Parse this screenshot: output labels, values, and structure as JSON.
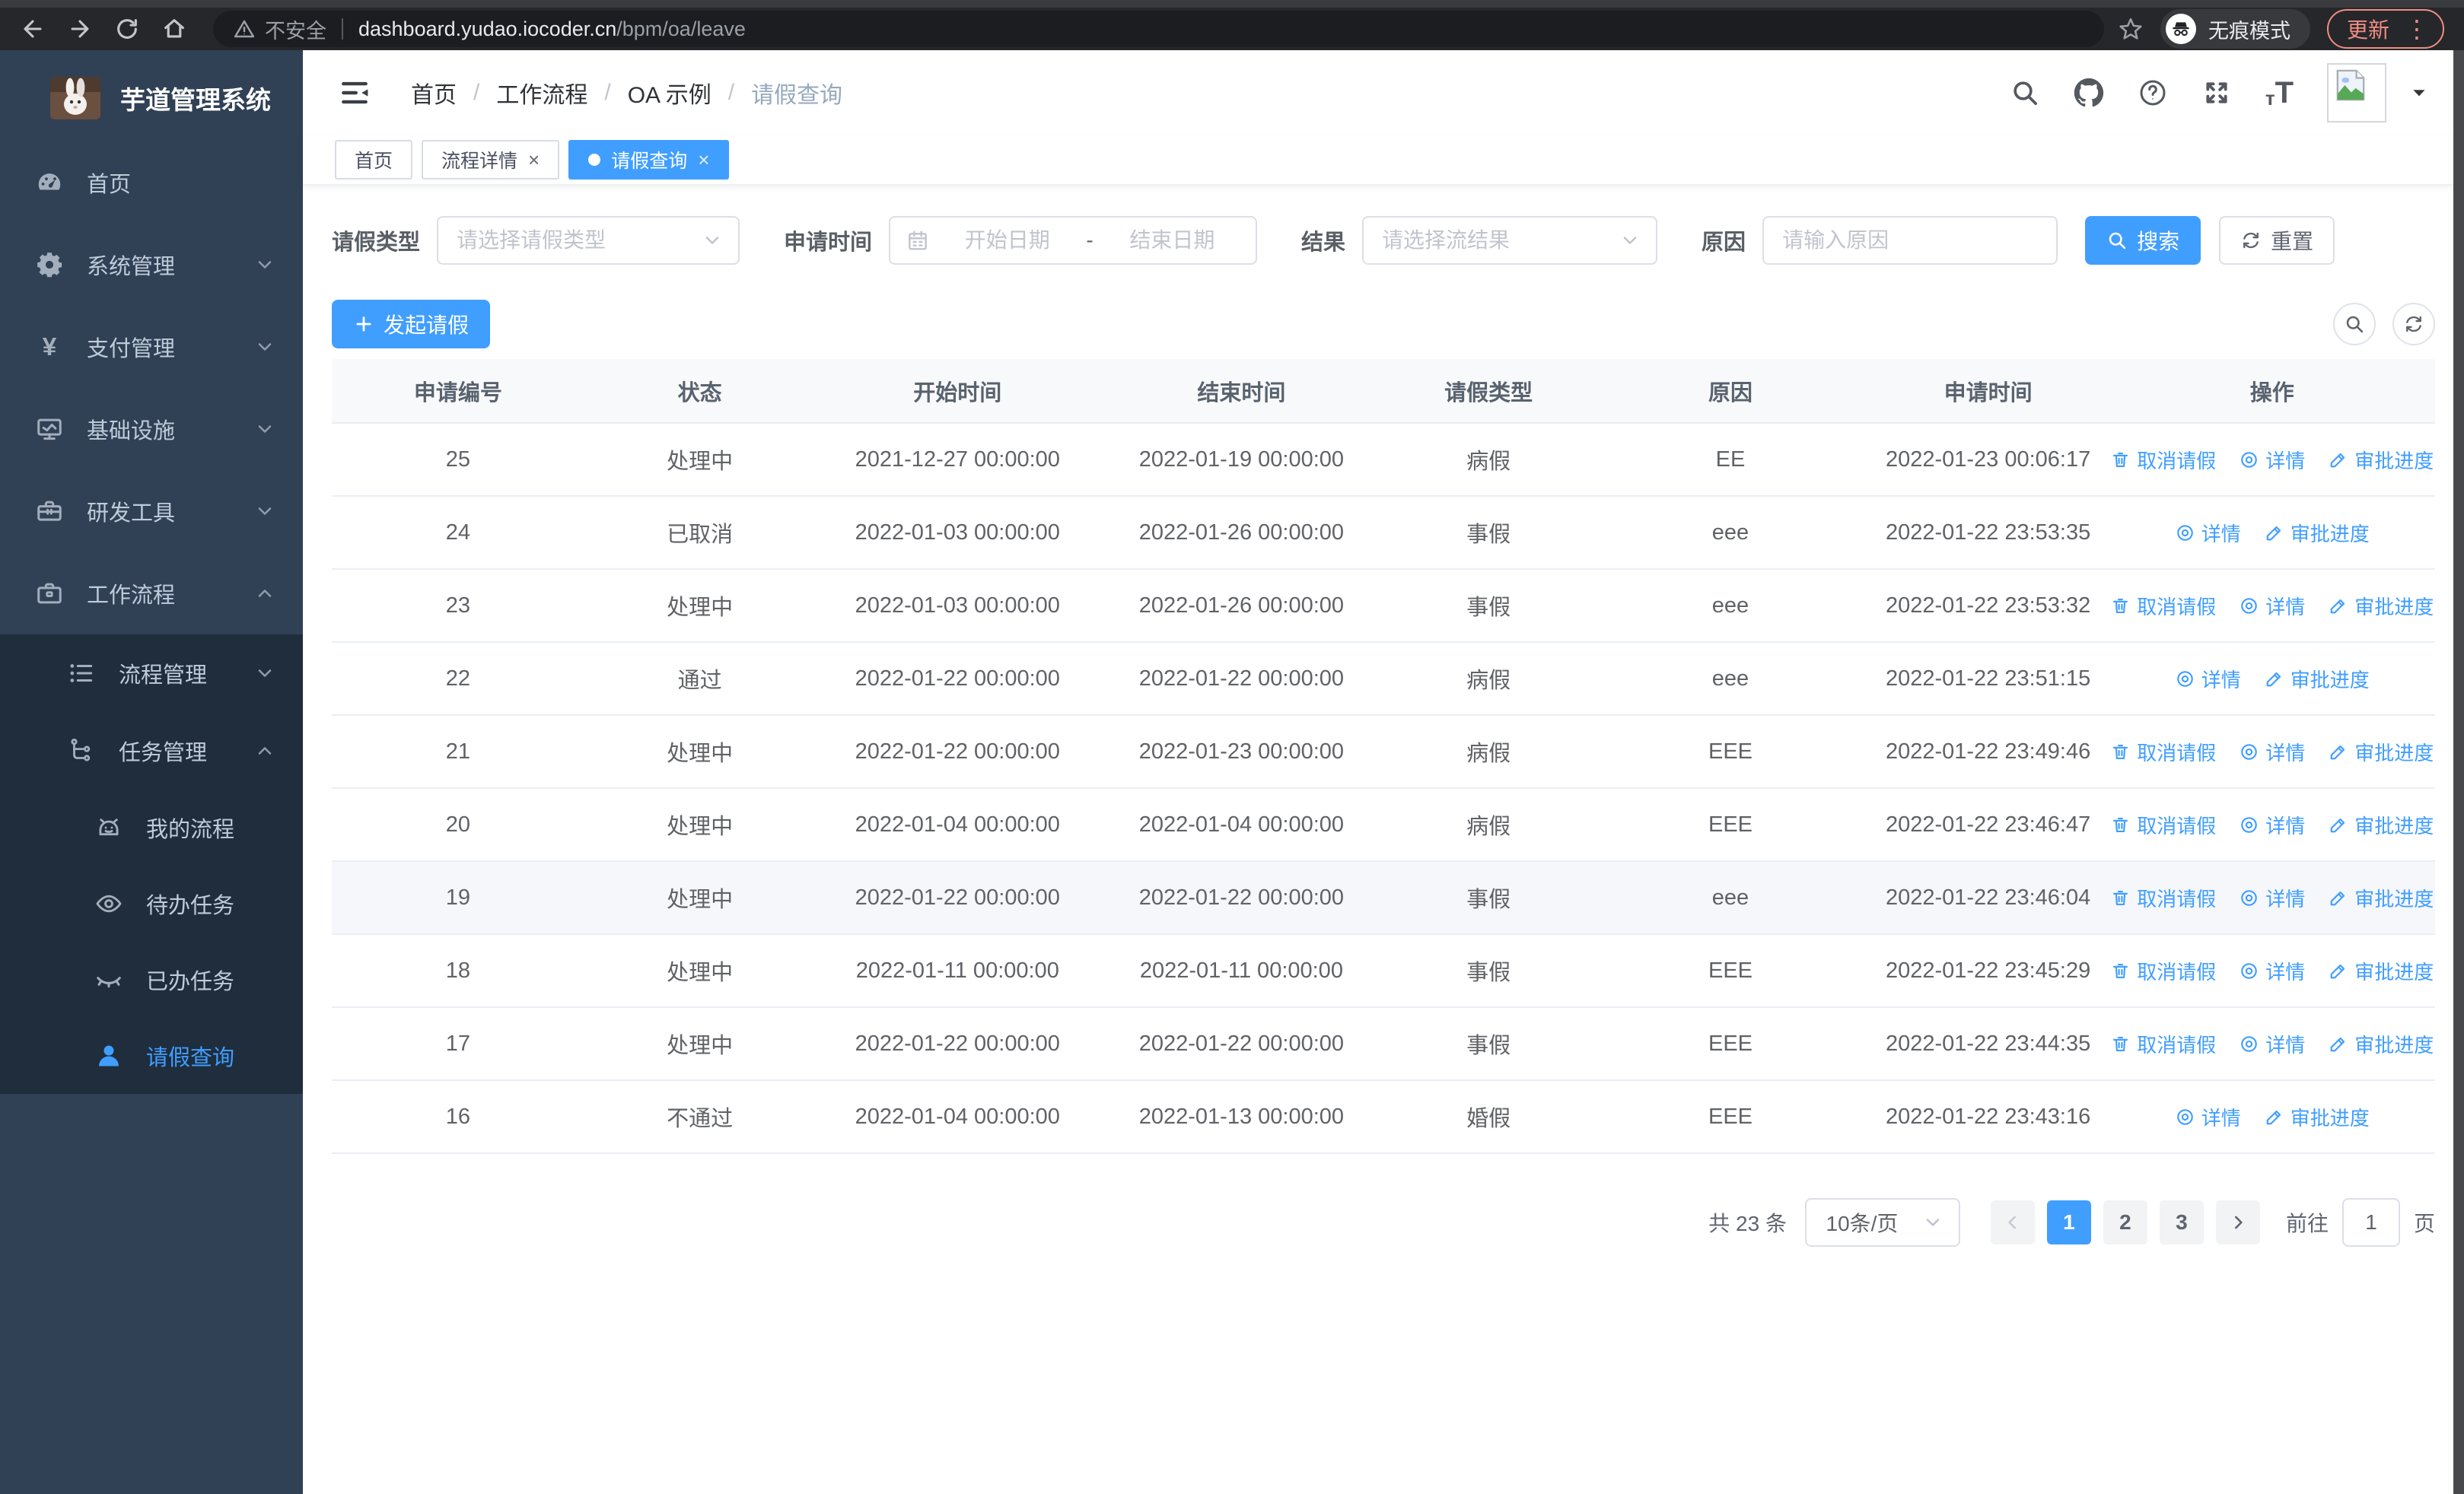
{
  "browser": {
    "security_text": "不安全",
    "url_host": "dashboard.yudao.iocoder.cn",
    "url_path": "/bpm/oa/leave",
    "incognito_label": "无痕模式",
    "update_label": "更新",
    "icons": [
      "back-icon",
      "forward-icon",
      "reload-icon",
      "home-icon",
      "warning-icon",
      "star-icon",
      "incognito-icon",
      "kebab-icon"
    ]
  },
  "colors": {
    "primary": "#409eff",
    "sidebar_bg": "#304156",
    "submenu_bg": "#1f2d3d",
    "update_accent": "#f08d83"
  },
  "sidebar": {
    "logo_title": "芋道管理系统",
    "items": [
      {
        "key": "home",
        "label": "首页",
        "icon": "dashboard-icon",
        "level": 1
      },
      {
        "key": "system-mgmt",
        "label": "系统管理",
        "icon": "gear-icon",
        "level": 1,
        "chevron": "down"
      },
      {
        "key": "payment-mgmt",
        "label": "支付管理",
        "icon": "yen-icon",
        "level": 1,
        "chevron": "down"
      },
      {
        "key": "infrastructure",
        "label": "基础设施",
        "icon": "monitor-icon",
        "level": 1,
        "chevron": "down"
      },
      {
        "key": "dev-tools",
        "label": "研发工具",
        "icon": "toolbox-icon",
        "level": 1,
        "chevron": "down"
      },
      {
        "key": "workflow",
        "label": "工作流程",
        "icon": "briefcase-icon",
        "level": 1,
        "chevron": "up"
      },
      {
        "key": "process-mgmt",
        "label": "流程管理",
        "icon": "list-icon",
        "level": 2,
        "chevron": "down",
        "sub": true
      },
      {
        "key": "task-mgmt",
        "label": "任务管理",
        "icon": "tree-icon",
        "level": 2,
        "chevron": "up",
        "sub": true
      },
      {
        "key": "my-process",
        "label": "我的流程",
        "icon": "robot-icon",
        "level": 3,
        "sub": true
      },
      {
        "key": "todo-tasks",
        "label": "待办任务",
        "icon": "eye-open-icon",
        "level": 3,
        "sub": true
      },
      {
        "key": "done-tasks",
        "label": "已办任务",
        "icon": "eye-closed-icon",
        "level": 3,
        "sub": true
      },
      {
        "key": "leave-query",
        "label": "请假查询",
        "icon": "user-icon",
        "level": 3,
        "sub": true,
        "active": true
      }
    ]
  },
  "header": {
    "breadcrumb": [
      {
        "label": "首页"
      },
      {
        "label": "工作流程"
      },
      {
        "label": "OA 示例"
      },
      {
        "label": "请假查询",
        "current": true
      }
    ],
    "icons": [
      "search-icon",
      "github-icon",
      "help-icon",
      "fullscreen-icon",
      "font-size-icon",
      "avatar",
      "caret-down-icon"
    ]
  },
  "tabs": [
    {
      "key": "home",
      "label": "首页"
    },
    {
      "key": "process-detail",
      "label": "流程详情",
      "closable": true
    },
    {
      "key": "leave-query",
      "label": "请假查询",
      "closable": true,
      "active": true
    }
  ],
  "filters": {
    "leave_type_label": "请假类型",
    "leave_type_placeholder": "请选择请假类型",
    "apply_time_label": "申请时间",
    "start_placeholder": "开始日期",
    "range_separator": "-",
    "end_placeholder": "结束日期",
    "result_label": "结果",
    "result_placeholder": "请选择流结果",
    "reason_label": "原因",
    "reason_placeholder": "请输入原因",
    "search_label": "搜索",
    "reset_label": "重置"
  },
  "toolbar": {
    "create_label": "发起请假"
  },
  "table": {
    "columns": [
      "申请编号",
      "状态",
      "开始时间",
      "结束时间",
      "请假类型",
      "原因",
      "申请时间",
      "操作"
    ],
    "action_labels": {
      "cancel": "取消请假",
      "detail": "详情",
      "progress": "审批进度"
    },
    "rows": [
      {
        "id": "25",
        "status": "处理中",
        "start": "2021-12-27 00:00:00",
        "end": "2022-01-19 00:00:00",
        "type": "病假",
        "reason": "EE",
        "applied": "2022-01-23 00:06:17",
        "cancellable": true
      },
      {
        "id": "24",
        "status": "已取消",
        "start": "2022-01-03 00:00:00",
        "end": "2022-01-26 00:00:00",
        "type": "事假",
        "reason": "eee",
        "applied": "2022-01-22 23:53:35",
        "cancellable": false
      },
      {
        "id": "23",
        "status": "处理中",
        "start": "2022-01-03 00:00:00",
        "end": "2022-01-26 00:00:00",
        "type": "事假",
        "reason": "eee",
        "applied": "2022-01-22 23:53:32",
        "cancellable": true
      },
      {
        "id": "22",
        "status": "通过",
        "start": "2022-01-22 00:00:00",
        "end": "2022-01-22 00:00:00",
        "type": "病假",
        "reason": "eee",
        "applied": "2022-01-22 23:51:15",
        "cancellable": false
      },
      {
        "id": "21",
        "status": "处理中",
        "start": "2022-01-22 00:00:00",
        "end": "2022-01-23 00:00:00",
        "type": "病假",
        "reason": "EEE",
        "applied": "2022-01-22 23:49:46",
        "cancellable": true
      },
      {
        "id": "20",
        "status": "处理中",
        "start": "2022-01-04 00:00:00",
        "end": "2022-01-04 00:00:00",
        "type": "病假",
        "reason": "EEE",
        "applied": "2022-01-22 23:46:47",
        "cancellable": true
      },
      {
        "id": "19",
        "status": "处理中",
        "start": "2022-01-22 00:00:00",
        "end": "2022-01-22 00:00:00",
        "type": "事假",
        "reason": "eee",
        "applied": "2022-01-22 23:46:04",
        "cancellable": true,
        "highlighted": true
      },
      {
        "id": "18",
        "status": "处理中",
        "start": "2022-01-11 00:00:00",
        "end": "2022-01-11 00:00:00",
        "type": "事假",
        "reason": "EEE",
        "applied": "2022-01-22 23:45:29",
        "cancellable": true
      },
      {
        "id": "17",
        "status": "处理中",
        "start": "2022-01-22 00:00:00",
        "end": "2022-01-22 00:00:00",
        "type": "事假",
        "reason": "EEE",
        "applied": "2022-01-22 23:44:35",
        "cancellable": true
      },
      {
        "id": "16",
        "status": "不通过",
        "start": "2022-01-04 00:00:00",
        "end": "2022-01-13 00:00:00",
        "type": "婚假",
        "reason": "EEE",
        "applied": "2022-01-22 23:43:16",
        "cancellable": false
      }
    ]
  },
  "pagination": {
    "total_text": "共 23 条",
    "page_size": "10条/页",
    "pages": [
      {
        "label": "1",
        "active": true
      },
      {
        "label": "2"
      },
      {
        "label": "3"
      }
    ],
    "jump_prefix": "前往",
    "jump_value": "1",
    "jump_suffix": "页"
  }
}
